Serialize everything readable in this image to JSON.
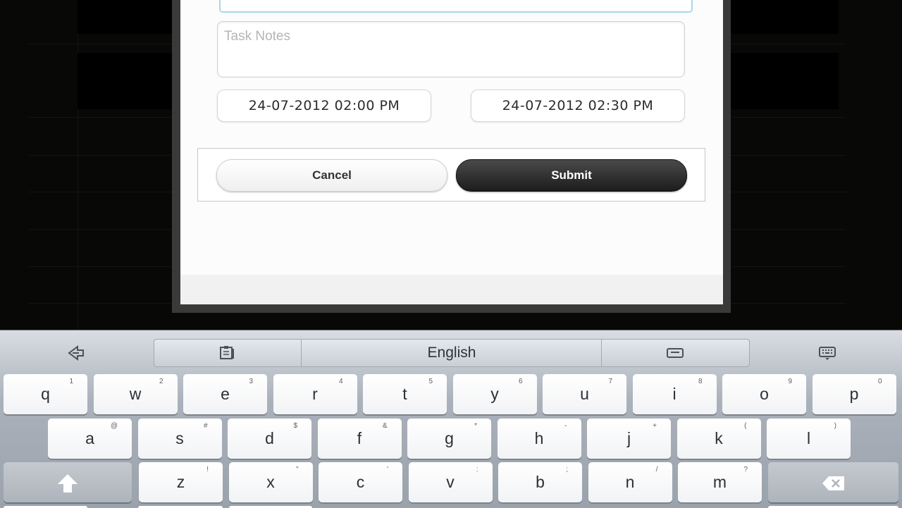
{
  "dialog": {
    "notes_placeholder": "Task Notes",
    "start_datetime": "24-07-2012 02:00 PM",
    "end_datetime": "24-07-2012 02:30 PM",
    "cancel_label": "Cancel",
    "submit_label": "Submit"
  },
  "keyboard": {
    "language_label": "English",
    "icons": [
      "keyboard-collapse-icon",
      "clipboard-icon",
      "space-icon",
      "keyboard-settings-icon",
      "shift-icon",
      "backspace-icon"
    ],
    "row1": [
      {
        "key": "q",
        "sub": "1"
      },
      {
        "key": "w",
        "sub": "2"
      },
      {
        "key": "e",
        "sub": "3"
      },
      {
        "key": "r",
        "sub": "4"
      },
      {
        "key": "t",
        "sub": "5"
      },
      {
        "key": "y",
        "sub": "6"
      },
      {
        "key": "u",
        "sub": "7"
      },
      {
        "key": "i",
        "sub": "8"
      },
      {
        "key": "o",
        "sub": "9"
      },
      {
        "key": "p",
        "sub": "0"
      }
    ],
    "row2": [
      {
        "key": "a",
        "sub": "@"
      },
      {
        "key": "s",
        "sub": "#"
      },
      {
        "key": "d",
        "sub": "$"
      },
      {
        "key": "f",
        "sub": "&"
      },
      {
        "key": "g",
        "sub": "*"
      },
      {
        "key": "h",
        "sub": "-"
      },
      {
        "key": "j",
        "sub": "+"
      },
      {
        "key": "k",
        "sub": "("
      },
      {
        "key": "l",
        "sub": ")"
      }
    ],
    "row3": [
      {
        "key": "z",
        "sub": "!"
      },
      {
        "key": "x",
        "sub": "\""
      },
      {
        "key": "c",
        "sub": "'"
      },
      {
        "key": "v",
        "sub": ":"
      },
      {
        "key": "b",
        "sub": ";"
      },
      {
        "key": "n",
        "sub": "/"
      },
      {
        "key": "m",
        "sub": "?"
      }
    ]
  }
}
